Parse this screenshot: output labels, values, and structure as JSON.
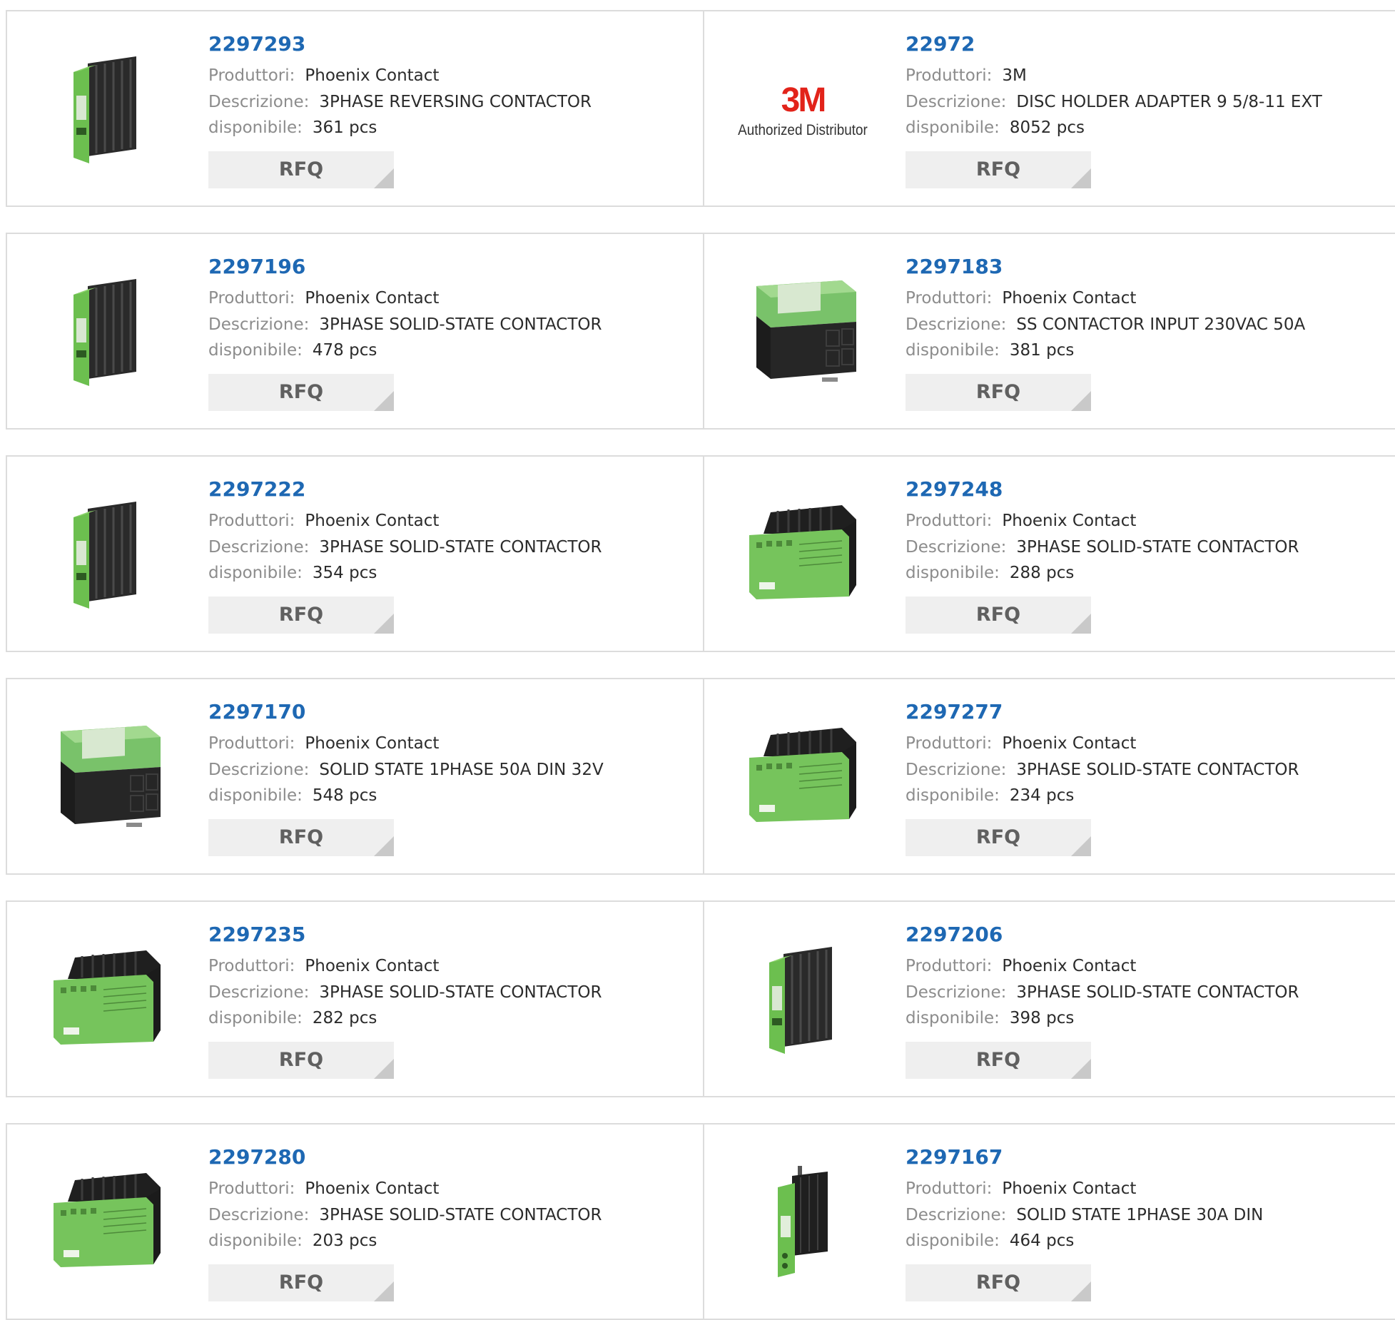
{
  "labels": {
    "manufacturer": "Produttori:",
    "description": "Descrizione:",
    "available": "disponibile:"
  },
  "rfq_label": "RFQ",
  "logo_3m": {
    "mark": "3M",
    "tagline": "Authorized Distributor"
  },
  "colors": {
    "link": "#1e68b3",
    "label": "#8c8c8c",
    "module_green": "#6cbf4f",
    "brand_red": "#e2231a"
  },
  "products": [
    {
      "part": "2297293",
      "manufacturer": "Phoenix Contact",
      "description": "3PHASE REVERSING CONTACTOR",
      "stock": "361 pcs",
      "image": "slim-din-module-icon"
    },
    {
      "part": "22972",
      "manufacturer": "3M",
      "description": "DISC HOLDER ADAPTER 9 5/8-11 EXT",
      "stock": "8052 pcs",
      "image": "3m-logo"
    },
    {
      "part": "2297196",
      "manufacturer": "Phoenix Contact",
      "description": "3PHASE SOLID-STATE CONTACTOR",
      "stock": "478 pcs",
      "image": "slim-din-module-icon"
    },
    {
      "part": "2297183",
      "manufacturer": "Phoenix Contact",
      "description": "SS CONTACTOR INPUT 230VAC 50A",
      "stock": "381 pcs",
      "image": "heatsink-relay-icon"
    },
    {
      "part": "2297222",
      "manufacturer": "Phoenix Contact",
      "description": "3PHASE SOLID-STATE CONTACTOR",
      "stock": "354 pcs",
      "image": "slim-din-module-icon"
    },
    {
      "part": "2297248",
      "manufacturer": "Phoenix Contact",
      "description": "3PHASE SOLID-STATE CONTACTOR",
      "stock": "288 pcs",
      "image": "wide-contactor-icon"
    },
    {
      "part": "2297170",
      "manufacturer": "Phoenix Contact",
      "description": "SOLID STATE 1PHASE 50A DIN 32V",
      "stock": "548 pcs",
      "image": "heatsink-relay-icon"
    },
    {
      "part": "2297277",
      "manufacturer": "Phoenix Contact",
      "description": "3PHASE SOLID-STATE CONTACTOR",
      "stock": "234 pcs",
      "image": "wide-contactor-icon"
    },
    {
      "part": "2297235",
      "manufacturer": "Phoenix Contact",
      "description": "3PHASE SOLID-STATE CONTACTOR",
      "stock": "282 pcs",
      "image": "wide-contactor-icon"
    },
    {
      "part": "2297206",
      "manufacturer": "Phoenix Contact",
      "description": "3PHASE SOLID-STATE CONTACTOR",
      "stock": "398 pcs",
      "image": "slim-din-module-icon"
    },
    {
      "part": "2297280",
      "manufacturer": "Phoenix Contact",
      "description": "3PHASE SOLID-STATE CONTACTOR",
      "stock": "203 pcs",
      "image": "wide-contactor-icon"
    },
    {
      "part": "2297167",
      "manufacturer": "Phoenix Contact",
      "description": "SOLID STATE 1PHASE 30A DIN",
      "stock": "464 pcs",
      "image": "single-relay-icon"
    }
  ]
}
